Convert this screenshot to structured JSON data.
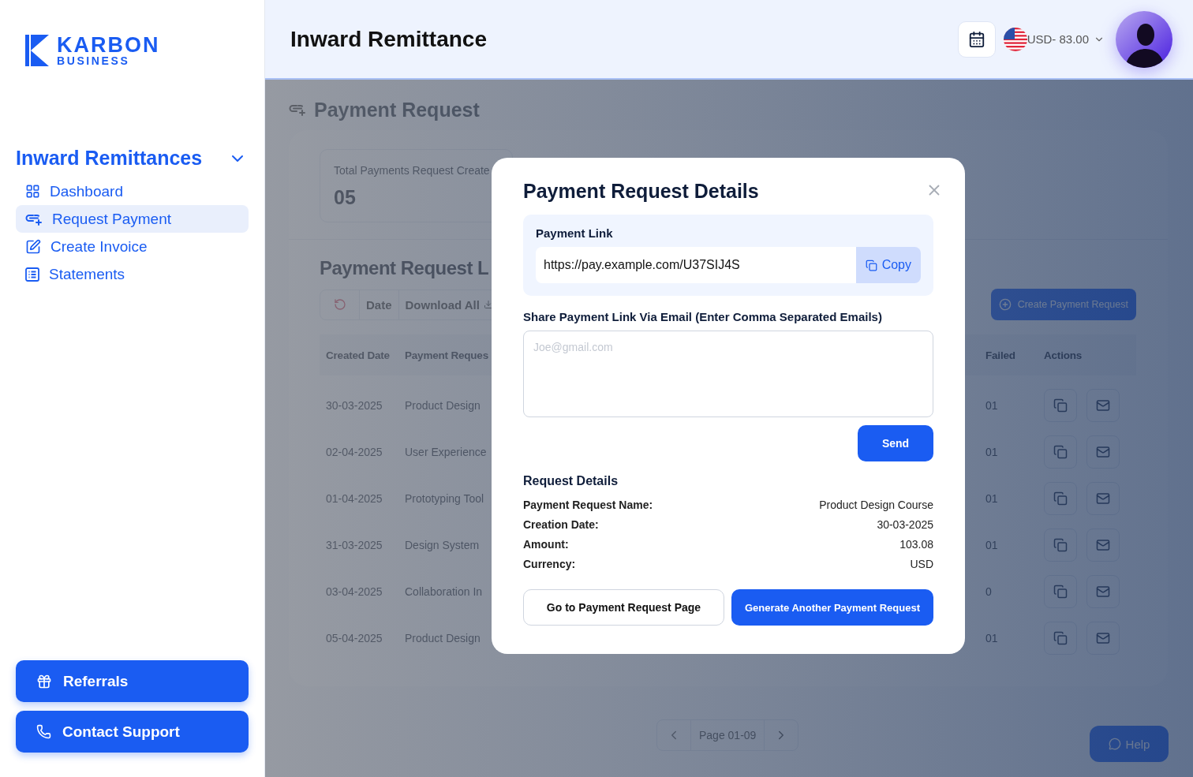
{
  "sidebar": {
    "logo": {
      "name": "KARBON",
      "tagline": "BUSINESS"
    },
    "section": {
      "title": "Inward Remittances",
      "expanded": true
    },
    "items": [
      {
        "label": "Dashboard",
        "selected": false
      },
      {
        "label": "Request Payment",
        "selected": true
      },
      {
        "label": "Create Invoice",
        "selected": false
      },
      {
        "label": "Statements",
        "selected": false
      }
    ],
    "bottom_buttons": [
      {
        "label": "Referrals"
      },
      {
        "label": "Contact Support"
      }
    ]
  },
  "header": {
    "title": "Inward Remittance",
    "currency": "USD- 83.00"
  },
  "page": {
    "title": "Payment Request",
    "stat": {
      "label": "Total Payments Request Create",
      "value": "05"
    },
    "list_title": "Payment Request L",
    "toolbar": [
      "Date",
      "Download All"
    ],
    "create_button": "Create Payment Request",
    "columns": {
      "created": "Created Date",
      "name": "Payment Reques",
      "failed": "Failed",
      "actions": "Actions"
    },
    "rows": [
      {
        "date": "30-03-2025",
        "name": "Product Design",
        "failed": "01"
      },
      {
        "date": "02-04-2025",
        "name": "User Experience",
        "failed": "01"
      },
      {
        "date": "01-04-2025",
        "name": "Prototyping Tool",
        "failed": "01"
      },
      {
        "date": "31-03-2025",
        "name": "Design System",
        "failed": "01"
      },
      {
        "date": "03-04-2025",
        "name": "Collaboration In",
        "failed": "0"
      },
      {
        "date": "05-04-2025",
        "name": "Product Design",
        "failed": "01"
      }
    ],
    "pagination": "Page 01-09",
    "help": "Help"
  },
  "modal": {
    "title": "Payment Request Details",
    "link_label": "Payment Link",
    "link": "https://pay.example.com/U37SIJ4S",
    "copy": "Copy",
    "share_label": "Share Payment Link Via Email (Enter Comma Separated Emails)",
    "email_placeholder": "Joe@gmail.com",
    "send": "Send",
    "details_title": "Request Details",
    "details": [
      {
        "label": "Payment Request Name:",
        "value": "Product Design Course"
      },
      {
        "label": "Creation Date:",
        "value": "30-03-2025"
      },
      {
        "label": "Amount:",
        "value": "103.08"
      },
      {
        "label": "Currency:",
        "value": "USD"
      }
    ],
    "buttons": [
      "Go to Payment Request Page",
      "Generate Another Payment Request"
    ]
  }
}
